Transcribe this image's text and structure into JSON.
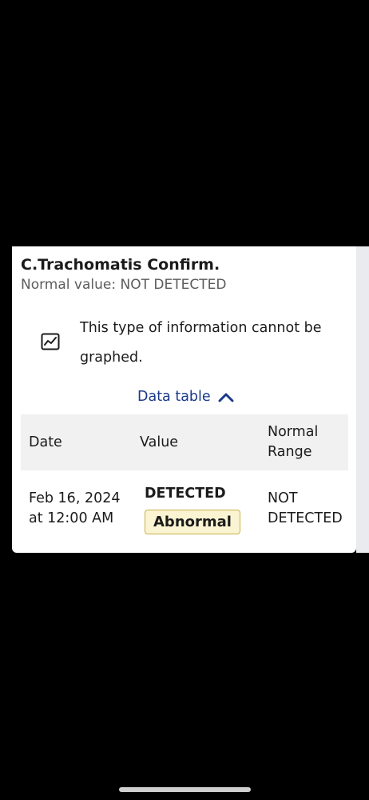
{
  "card": {
    "title": "C.Trachomatis Confirm.",
    "normal_value": "Normal value: NOT DETECTED",
    "graph_note": "This type of information cannot be graphed.",
    "graph_icon": "chart-trend-icon",
    "toggle_label": "Data table",
    "toggle_icon": "chevron-up-icon"
  },
  "table": {
    "headers": {
      "date": "Date",
      "value": "Value",
      "range_line1": "Normal",
      "range_line2": "Range"
    },
    "rows": [
      {
        "date_line1": "Feb 16, 2024",
        "date_line2": "at 12:00 AM",
        "value": "DETECTED",
        "flag": "Abnormal",
        "range_line1": "NOT",
        "range_line2": "DETECTED"
      }
    ]
  },
  "colors": {
    "link": "#1a3a8a",
    "badge_bg": "#fbf4d2",
    "badge_border": "#c8b24a",
    "header_bg": "#f1f1f1"
  }
}
